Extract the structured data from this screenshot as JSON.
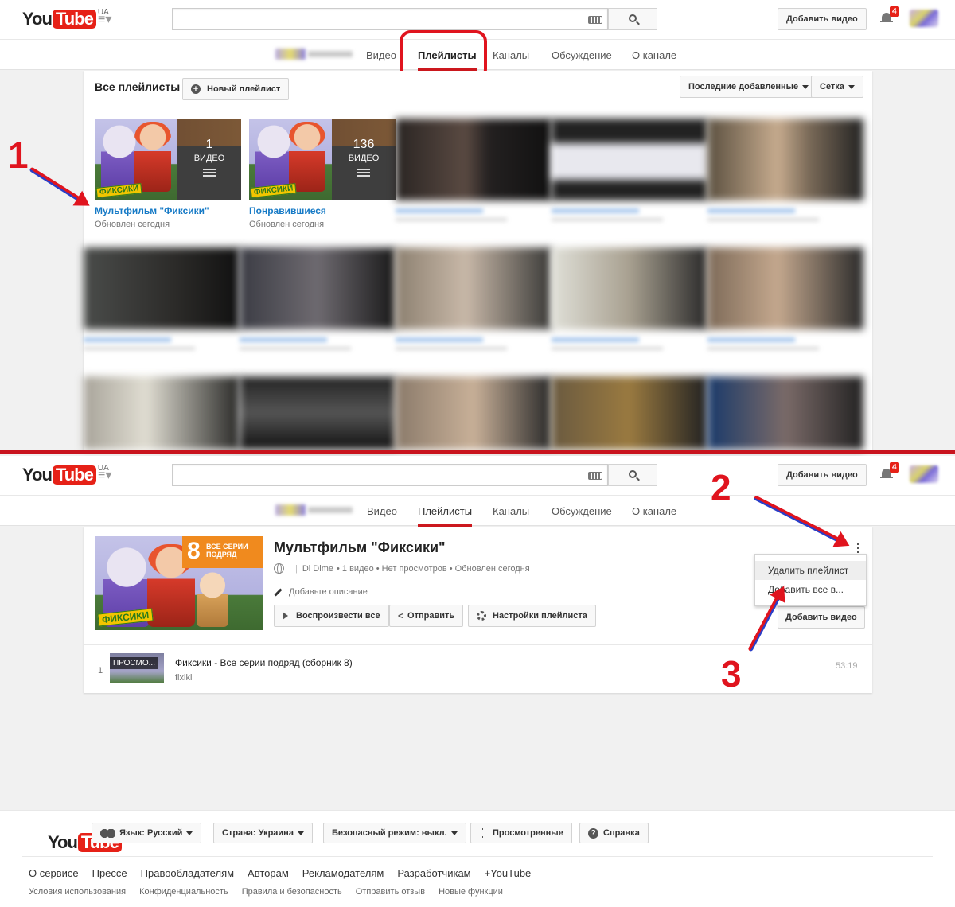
{
  "header": {
    "logo_you": "You",
    "logo_tube": "Tube",
    "region": "UA",
    "upload_label": "Добавить видео",
    "notifications_count": "4"
  },
  "channel_nav": {
    "tabs": [
      "Видео",
      "Плейлисты",
      "Каналы",
      "Обсуждение",
      "О канале"
    ]
  },
  "playlists_page": {
    "title": "Все плейлисты",
    "new_playlist_label": "Новый плейлист",
    "sort_label": "Последние добавленные",
    "view_label": "Сетка",
    "tiles": [
      {
        "title": "Мультфильм \"Фиксики\"",
        "updated": "Обновлен сегодня",
        "count": "1",
        "count_label": "ВИДЕО"
      },
      {
        "title": "Понравившиеся",
        "updated": "Обновлен сегодня",
        "count": "136",
        "count_label": "ВИДЕО"
      }
    ]
  },
  "annotations": {
    "step1": "1",
    "step2": "2",
    "step3": "3"
  },
  "playlist_detail": {
    "thumb_number": "8",
    "thumb_caption": "ВСЕ СЕРИИ ПОДРЯД",
    "thumb_logo": "ФИКСИКИ",
    "title": "Мультфильм \"Фиксики\"",
    "owner": "Di Dime",
    "stats": "• 1 видео • Нет просмотров • Обновлен сегодня",
    "add_description": "Добавьте описание",
    "play_all": "Воспроизвести все",
    "share": "Отправить",
    "settings": "Настройки плейлиста",
    "ghost_add": "Добавить видео",
    "menu": [
      "Удалить плейлист",
      "Добавить все в..."
    ],
    "video": {
      "index": "1",
      "thumb_label": "ПРОСМО...",
      "title": "Фиксики - Все серии подряд (сборник 8)",
      "channel": "fixiki",
      "duration": "53:19"
    }
  },
  "footer": {
    "language": "Язык: Русский",
    "country": "Страна: Украина",
    "safety": "Безопасный режим: выкл.",
    "history": "Просмотренные",
    "help": "Справка",
    "links": [
      "О сервисе",
      "Прессе",
      "Правообладателям",
      "Авторам",
      "Рекламодателям",
      "Разработчикам",
      "+YouTube"
    ],
    "links2": [
      "Условия использования",
      "Конфиденциальность",
      "Правила и безопасность",
      "Отправить отзыв",
      "Новые функции"
    ]
  },
  "colors": {
    "accent": "#e62117",
    "annotation": "#e0141e",
    "link": "#167ac6"
  }
}
